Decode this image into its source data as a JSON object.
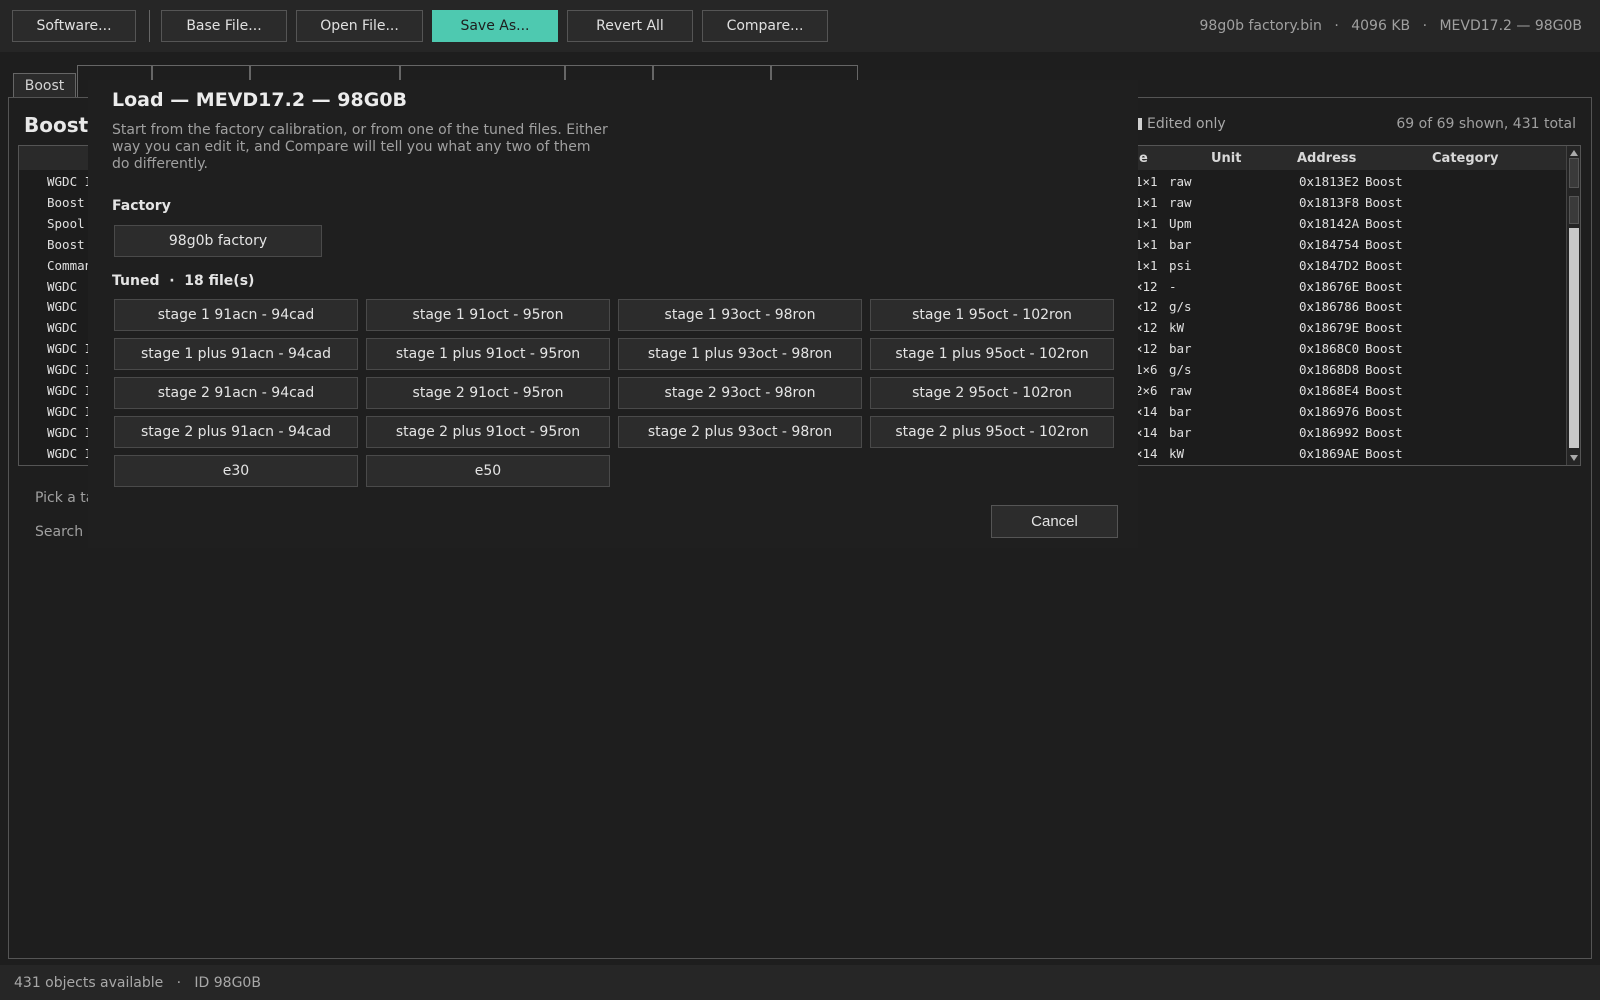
{
  "toolbar": {
    "buttons": [
      {
        "label": "Software..."
      },
      {
        "label": "Base File..."
      },
      {
        "label": "Open File..."
      },
      {
        "label": "Save As..."
      },
      {
        "label": "Revert All"
      },
      {
        "label": "Compare..."
      }
    ],
    "file_name": "98g0b factory.bin",
    "file_size": "4096 KB",
    "software": "MEVD17.2 — 98G0B",
    "separator": "·",
    "accent_color": "#4ec9b0"
  },
  "tabs": {
    "active": "Boost"
  },
  "panel": {
    "title": "Boost",
    "edited_only_label": "Edited only",
    "count_text": "69 of 69 shown, 431 total",
    "pick_hint": "Pick a ta",
    "search_hint": "Search"
  },
  "table": {
    "columns": [
      "e",
      "Unit",
      "Address",
      "Category"
    ],
    "rows": [
      {
        "name": "WGDC I",
        "size": "1×1",
        "unit": "raw",
        "address": "0x1813E2",
        "category": "Boost"
      },
      {
        "name": "Boost",
        "size": "1×1",
        "unit": "raw",
        "address": "0x1813F8",
        "category": "Boost"
      },
      {
        "name": "Spool",
        "size": "1×1",
        "unit": "Upm",
        "address": "0x18142A",
        "category": "Boost"
      },
      {
        "name": "Boost",
        "size": "1×1",
        "unit": "bar",
        "address": "0x184754",
        "category": "Boost"
      },
      {
        "name": "Comman",
        "size": "1×1",
        "unit": "psi",
        "address": "0x1847D2",
        "category": "Boost"
      },
      {
        "name": "WGDC",
        "size": "×12",
        "unit": "-",
        "address": "0x18676E",
        "category": "Boost"
      },
      {
        "name": "WGDC",
        "size": "×12",
        "unit": "g/s",
        "address": "0x186786",
        "category": "Boost"
      },
      {
        "name": "WGDC",
        "size": "×12",
        "unit": "kW",
        "address": "0x18679E",
        "category": "Boost"
      },
      {
        "name": "WGDC I",
        "size": "×12",
        "unit": "bar",
        "address": "0x1868C0",
        "category": "Boost"
      },
      {
        "name": "WGDC I",
        "size": "1×6",
        "unit": "g/s",
        "address": "0x1868D8",
        "category": "Boost"
      },
      {
        "name": "WGDC I",
        "size": "2×6",
        "unit": "raw",
        "address": "0x1868E4",
        "category": "Boost"
      },
      {
        "name": "WGDC I",
        "size": "×14",
        "unit": "bar",
        "address": "0x186976",
        "category": "Boost"
      },
      {
        "name": "WGDC I",
        "size": "×14",
        "unit": "bar",
        "address": "0x186992",
        "category": "Boost"
      },
      {
        "name": "WGDC I",
        "size": "×14",
        "unit": "kW",
        "address": "0x1869AE",
        "category": "Boost"
      }
    ]
  },
  "modal": {
    "title": "Load — MEVD17.2 — 98G0B",
    "description": "Start from the factory calibration, or from one of the tuned files. Either way you can edit it, and Compare will tell you what any two of them do differently.",
    "factory_heading": "Factory",
    "factory_button": "98g0b factory",
    "tuned_heading": "Tuned  ·  18 file(s)",
    "tuned_files": [
      "stage 1 91acn - 94cad",
      "stage 1 91oct - 95ron",
      "stage 1 93oct - 98ron",
      "stage 1 95oct - 102ron",
      "stage 1 plus 91acn - 94cad",
      "stage 1 plus 91oct - 95ron",
      "stage 1 plus 93oct - 98ron",
      "stage 1 plus 95oct - 102ron",
      "stage 2 91acn - 94cad",
      "stage 2 91oct - 95ron",
      "stage 2 93oct - 98ron",
      "stage 2 95oct - 102ron",
      "stage 2 plus 91acn - 94cad",
      "stage 2 plus 91oct - 95ron",
      "stage 2 plus 93oct - 98ron",
      "stage 2 plus 95oct - 102ron",
      "e30",
      "e50"
    ],
    "cancel_label": "Cancel"
  },
  "status": {
    "text": "431 objects available   ·   ID 98G0B"
  }
}
